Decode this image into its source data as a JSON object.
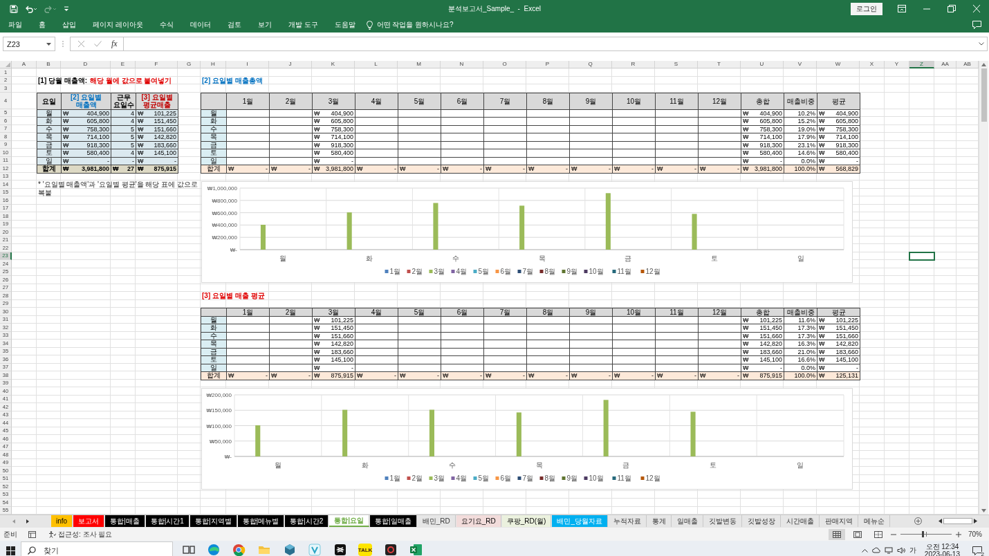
{
  "window": {
    "title": "분석보고서_Sample_  -  Excel",
    "login_button": "로그인"
  },
  "ribbon": {
    "tabs": [
      "파일",
      "홈",
      "삽입",
      "페이지 레이아웃",
      "수식",
      "데이터",
      "검토",
      "보기",
      "개발 도구",
      "도움말"
    ],
    "tell_me": "어떤 작업을 원하시나요?"
  },
  "formula_bar": {
    "name_box": "Z23",
    "function_button": "fx"
  },
  "sheet": {
    "columns": [
      {
        "label": "A",
        "selected": false
      },
      {
        "label": "B",
        "selected": false
      },
      {
        "label": "D",
        "selected": false
      },
      {
        "label": "E",
        "selected": false
      },
      {
        "label": "F",
        "selected": false
      },
      {
        "label": "G",
        "selected": false
      },
      {
        "label": "H",
        "selected": false
      },
      {
        "label": "I",
        "selected": false
      },
      {
        "label": "J",
        "selected": false
      },
      {
        "label": "K",
        "selected": false
      },
      {
        "label": "L",
        "selected": false
      },
      {
        "label": "M",
        "selected": false
      },
      {
        "label": "N",
        "selected": false
      },
      {
        "label": "O",
        "selected": false
      },
      {
        "label": "P",
        "selected": false
      },
      {
        "label": "Q",
        "selected": false
      },
      {
        "label": "R",
        "selected": false
      },
      {
        "label": "S",
        "selected": false
      },
      {
        "label": "T",
        "selected": false
      },
      {
        "label": "U",
        "selected": false
      },
      {
        "label": "V",
        "selected": false
      },
      {
        "label": "W",
        "selected": false
      },
      {
        "label": "X",
        "selected": false
      },
      {
        "label": "Y",
        "selected": false
      },
      {
        "label": "Z",
        "selected": true
      },
      {
        "label": "AA",
        "selected": false
      },
      {
        "label": "AB",
        "selected": false
      }
    ],
    "rows": [
      {
        "label": "1",
        "selected": false
      },
      {
        "label": "2",
        "selected": false
      },
      {
        "label": "3",
        "selected": false
      },
      {
        "label": "4",
        "selected": false
      },
      {
        "label": "5",
        "selected": false
      },
      {
        "label": "6",
        "selected": false
      },
      {
        "label": "7",
        "selected": false
      },
      {
        "label": "8",
        "selected": false
      },
      {
        "label": "9",
        "selected": false
      },
      {
        "label": "10",
        "selected": false
      },
      {
        "label": "11",
        "selected": false
      },
      {
        "label": "12",
        "selected": false
      },
      {
        "label": "13",
        "selected": false
      },
      {
        "label": "14",
        "selected": false
      },
      {
        "label": "15",
        "selected": false
      },
      {
        "label": "16",
        "selected": false
      },
      {
        "label": "17",
        "selected": false
      },
      {
        "label": "18",
        "selected": false
      },
      {
        "label": "19",
        "selected": false
      },
      {
        "label": "20",
        "selected": false
      },
      {
        "label": "21",
        "selected": false
      },
      {
        "label": "22",
        "selected": false
      },
      {
        "label": "23",
        "selected": true
      },
      {
        "label": "24",
        "selected": false
      },
      {
        "label": "25",
        "selected": false
      },
      {
        "label": "26",
        "selected": false
      },
      {
        "label": "27",
        "selected": false
      },
      {
        "label": "28",
        "selected": false
      },
      {
        "label": "29",
        "selected": false
      },
      {
        "label": "30",
        "selected": false
      },
      {
        "label": "31",
        "selected": false
      },
      {
        "label": "32",
        "selected": false
      },
      {
        "label": "33",
        "selected": false
      },
      {
        "label": "34",
        "selected": false
      },
      {
        "label": "35",
        "selected": false
      },
      {
        "label": "36",
        "selected": false
      },
      {
        "label": "37",
        "selected": false
      },
      {
        "label": "38",
        "selected": false
      },
      {
        "label": "39",
        "selected": false
      },
      {
        "label": "40",
        "selected": false
      },
      {
        "label": "41",
        "selected": false
      },
      {
        "label": "42",
        "selected": false
      },
      {
        "label": "43",
        "selected": false
      },
      {
        "label": "44",
        "selected": false
      },
      {
        "label": "45",
        "selected": false
      },
      {
        "label": "46",
        "selected": false
      },
      {
        "label": "47",
        "selected": false
      },
      {
        "label": "48",
        "selected": false
      },
      {
        "label": "49",
        "selected": false
      },
      {
        "label": "50",
        "selected": false
      },
      {
        "label": "51",
        "selected": false
      },
      {
        "label": "52",
        "selected": false
      },
      {
        "label": "53",
        "selected": false
      },
      {
        "label": "54",
        "selected": false
      },
      {
        "label": "55",
        "selected": false
      }
    ],
    "section_1": {
      "title": "[1] 당월 매출액:",
      "hint": "해당 월에 값으로 붙여넣기",
      "columns": [
        {
          "label": "요일"
        },
        {
          "label": "[2] 요일별 매출액",
          "color": "#0070c0"
        },
        {
          "label": "근무 요일수"
        },
        {
          "label": "[3] 요일별 평균매출",
          "color": "#c00000"
        }
      ],
      "rows": [
        [
          "월",
          [
            "₩",
            "404,900"
          ],
          "4",
          [
            "₩",
            "101,225"
          ]
        ],
        [
          "화",
          [
            "₩",
            "605,800"
          ],
          "4",
          [
            "₩",
            "151,450"
          ]
        ],
        [
          "수",
          [
            "₩",
            "758,300"
          ],
          "5",
          [
            "₩",
            "151,660"
          ]
        ],
        [
          "목",
          [
            "₩",
            "714,100"
          ],
          "5",
          [
            "₩",
            "142,820"
          ]
        ],
        [
          "금",
          [
            "₩",
            "918,300"
          ],
          "5",
          [
            "₩",
            "183,660"
          ]
        ],
        [
          "토",
          [
            "₩",
            "580,400"
          ],
          "4",
          [
            "₩",
            "145,100"
          ]
        ],
        [
          "일",
          [
            "₩",
            "-"
          ],
          "-",
          [
            "₩",
            "-"
          ]
        ],
        [
          "합계",
          [
            "₩",
            "3,981,800"
          ],
          [
            "₩",
            "27"
          ],
          [
            "₩",
            "875,915"
          ]
        ]
      ],
      "note": "* '요일별 매출액'과 '요일별 평균'을 해당 표에 값으로 복붙"
    },
    "section_2": {
      "title": "[2] 요일별 매출총액",
      "columns": [
        "",
        "1월",
        "2월",
        "3월",
        "4월",
        "5월",
        "6월",
        "7월",
        "8월",
        "9월",
        "10월",
        "11월",
        "12월",
        "총합",
        "매출비중",
        "평균"
      ],
      "rows": [
        [
          "월",
          null,
          null,
          [
            "₩",
            "404,900"
          ],
          null,
          null,
          null,
          null,
          null,
          null,
          null,
          null,
          null,
          [
            "₩",
            "404,900"
          ],
          "10.2%",
          [
            "₩",
            "404,900"
          ]
        ],
        [
          "화",
          null,
          null,
          [
            "₩",
            "605,800"
          ],
          null,
          null,
          null,
          null,
          null,
          null,
          null,
          null,
          null,
          [
            "₩",
            "605,800"
          ],
          "15.2%",
          [
            "₩",
            "605,800"
          ]
        ],
        [
          "수",
          null,
          null,
          [
            "₩",
            "758,300"
          ],
          null,
          null,
          null,
          null,
          null,
          null,
          null,
          null,
          null,
          [
            "₩",
            "758,300"
          ],
          "19.0%",
          [
            "₩",
            "758,300"
          ]
        ],
        [
          "목",
          null,
          null,
          [
            "₩",
            "714,100"
          ],
          null,
          null,
          null,
          null,
          null,
          null,
          null,
          null,
          null,
          [
            "₩",
            "714,100"
          ],
          "17.9%",
          [
            "₩",
            "714,100"
          ]
        ],
        [
          "금",
          null,
          null,
          [
            "₩",
            "918,300"
          ],
          null,
          null,
          null,
          null,
          null,
          null,
          null,
          null,
          null,
          [
            "₩",
            "918,300"
          ],
          "23.1%",
          [
            "₩",
            "918,300"
          ]
        ],
        [
          "토",
          null,
          null,
          [
            "₩",
            "580,400"
          ],
          null,
          null,
          null,
          null,
          null,
          null,
          null,
          null,
          null,
          [
            "₩",
            "580,400"
          ],
          "14.6%",
          [
            "₩",
            "580,400"
          ]
        ],
        [
          "일",
          null,
          null,
          [
            "₩",
            "-"
          ],
          null,
          null,
          null,
          null,
          null,
          null,
          null,
          null,
          null,
          [
            "₩",
            "-"
          ],
          "0.0%",
          [
            "₩",
            "-"
          ]
        ],
        [
          "합계",
          [
            "₩",
            "-"
          ],
          [
            "₩",
            "-"
          ],
          [
            "₩",
            "3,981,800"
          ],
          [
            "₩",
            "-"
          ],
          [
            "₩",
            "-"
          ],
          [
            "₩",
            "-"
          ],
          [
            "₩",
            "-"
          ],
          [
            "₩",
            "-"
          ],
          [
            "₩",
            "-"
          ],
          [
            "₩",
            "-"
          ],
          [
            "₩",
            "-"
          ],
          [
            "₩",
            "-"
          ],
          [
            "₩",
            "3,981,800"
          ],
          "100.0%",
          [
            "₩",
            "568,829"
          ]
        ]
      ],
      "chart_data": {
        "type": "bar",
        "grid": true,
        "categories": [
          "월",
          "화",
          "수",
          "목",
          "금",
          "토",
          "일"
        ],
        "ylim": [
          0,
          1000000
        ],
        "yticks": [
          {
            "value": 0,
            "label": "₩-"
          },
          {
            "value": 200000,
            "label": "₩200,000"
          },
          {
            "value": 400000,
            "label": "₩400,000"
          },
          {
            "value": 600000,
            "label": "₩600,000"
          },
          {
            "value": 800000,
            "label": "₩800,000"
          },
          {
            "value": 1000000,
            "label": "₩1,000,000"
          }
        ],
        "series": [
          {
            "name": "1월",
            "color": "#4f81bd",
            "values": [
              null,
              null,
              null,
              null,
              null,
              null,
              null
            ]
          },
          {
            "name": "2월",
            "color": "#c0504d",
            "values": [
              null,
              null,
              null,
              null,
              null,
              null,
              null
            ]
          },
          {
            "name": "3월",
            "color": "#9bbb59",
            "values": [
              404900,
              605800,
              758300,
              714100,
              918300,
              580400,
              0
            ]
          },
          {
            "name": "4월",
            "color": "#8064a2",
            "values": [
              null,
              null,
              null,
              null,
              null,
              null,
              null
            ]
          },
          {
            "name": "5월",
            "color": "#4bacc6",
            "values": [
              null,
              null,
              null,
              null,
              null,
              null,
              null
            ]
          },
          {
            "name": "6월",
            "color": "#f79646",
            "values": [
              null,
              null,
              null,
              null,
              null,
              null,
              null
            ]
          },
          {
            "name": "7월",
            "color": "#2c4d75",
            "values": [
              null,
              null,
              null,
              null,
              null,
              null,
              null
            ]
          },
          {
            "name": "8월",
            "color": "#772c2a",
            "values": [
              null,
              null,
              null,
              null,
              null,
              null,
              null
            ]
          },
          {
            "name": "9월",
            "color": "#5f7530",
            "values": [
              null,
              null,
              null,
              null,
              null,
              null,
              null
            ]
          },
          {
            "name": "10월",
            "color": "#4d3b62",
            "values": [
              null,
              null,
              null,
              null,
              null,
              null,
              null
            ]
          },
          {
            "name": "11월",
            "color": "#276a7c",
            "values": [
              null,
              null,
              null,
              null,
              null,
              null,
              null
            ]
          },
          {
            "name": "12월",
            "color": "#b65708",
            "values": [
              null,
              null,
              null,
              null,
              null,
              null,
              null
            ]
          }
        ]
      }
    },
    "section_3": {
      "title": "[3] 요일별 매출 평균",
      "columns": [
        "",
        "1월",
        "2월",
        "3월",
        "4월",
        "5월",
        "6월",
        "7월",
        "8월",
        "9월",
        "10월",
        "11월",
        "12월",
        "총합",
        "매출비중",
        "평균"
      ],
      "rows": [
        [
          "월",
          null,
          null,
          [
            "₩",
            "101,225"
          ],
          null,
          null,
          null,
          null,
          null,
          null,
          null,
          null,
          null,
          [
            "₩",
            "101,225"
          ],
          "11.6%",
          [
            "₩",
            "101,225"
          ]
        ],
        [
          "화",
          null,
          null,
          [
            "₩",
            "151,450"
          ],
          null,
          null,
          null,
          null,
          null,
          null,
          null,
          null,
          null,
          [
            "₩",
            "151,450"
          ],
          "17.3%",
          [
            "₩",
            "151,450"
          ]
        ],
        [
          "수",
          null,
          null,
          [
            "₩",
            "151,660"
          ],
          null,
          null,
          null,
          null,
          null,
          null,
          null,
          null,
          null,
          [
            "₩",
            "151,660"
          ],
          "17.3%",
          [
            "₩",
            "151,660"
          ]
        ],
        [
          "목",
          null,
          null,
          [
            "₩",
            "142,820"
          ],
          null,
          null,
          null,
          null,
          null,
          null,
          null,
          null,
          null,
          [
            "₩",
            "142,820"
          ],
          "16.3%",
          [
            "₩",
            "142,820"
          ]
        ],
        [
          "금",
          null,
          null,
          [
            "₩",
            "183,660"
          ],
          null,
          null,
          null,
          null,
          null,
          null,
          null,
          null,
          null,
          [
            "₩",
            "183,660"
          ],
          "21.0%",
          [
            "₩",
            "183,660"
          ]
        ],
        [
          "토",
          null,
          null,
          [
            "₩",
            "145,100"
          ],
          null,
          null,
          null,
          null,
          null,
          null,
          null,
          null,
          null,
          [
            "₩",
            "145,100"
          ],
          "16.6%",
          [
            "₩",
            "145,100"
          ]
        ],
        [
          "일",
          null,
          null,
          [
            "₩",
            "-"
          ],
          null,
          null,
          null,
          null,
          null,
          null,
          null,
          null,
          null,
          [
            "₩",
            "-"
          ],
          "0.0%",
          [
            "₩",
            "-"
          ]
        ],
        [
          "합계",
          [
            "₩",
            "-"
          ],
          [
            "₩",
            "-"
          ],
          [
            "₩",
            "875,915"
          ],
          [
            "₩",
            "-"
          ],
          [
            "₩",
            "-"
          ],
          [
            "₩",
            "-"
          ],
          [
            "₩",
            "-"
          ],
          [
            "₩",
            "-"
          ],
          [
            "₩",
            "-"
          ],
          [
            "₩",
            "-"
          ],
          [
            "₩",
            "-"
          ],
          [
            "₩",
            "-"
          ],
          [
            "₩",
            "875,915"
          ],
          "100.0%",
          [
            "₩",
            "125,131"
          ]
        ]
      ],
      "chart_data": {
        "type": "bar",
        "grid": true,
        "categories": [
          "월",
          "화",
          "수",
          "목",
          "금",
          "토",
          "일"
        ],
        "ylim": [
          0,
          200000
        ],
        "yticks": [
          {
            "value": 0,
            "label": "₩-"
          },
          {
            "value": 50000,
            "label": "₩50,000"
          },
          {
            "value": 100000,
            "label": "₩100,000"
          },
          {
            "value": 150000,
            "label": "₩150,000"
          },
          {
            "value": 200000,
            "label": "₩200,000"
          }
        ],
        "series": [
          {
            "name": "1월",
            "color": "#4f81bd",
            "values": [
              null,
              null,
              null,
              null,
              null,
              null,
              null
            ]
          },
          {
            "name": "2월",
            "color": "#c0504d",
            "values": [
              null,
              null,
              null,
              null,
              null,
              null,
              null
            ]
          },
          {
            "name": "3월",
            "color": "#9bbb59",
            "values": [
              101225,
              151450,
              151660,
              142820,
              183660,
              145100,
              0
            ]
          },
          {
            "name": "4월",
            "color": "#8064a2",
            "values": [
              null,
              null,
              null,
              null,
              null,
              null,
              null
            ]
          },
          {
            "name": "5월",
            "color": "#4bacc6",
            "values": [
              null,
              null,
              null,
              null,
              null,
              null,
              null
            ]
          },
          {
            "name": "6월",
            "color": "#f79646",
            "values": [
              null,
              null,
              null,
              null,
              null,
              null,
              null
            ]
          },
          {
            "name": "7월",
            "color": "#2c4d75",
            "values": [
              null,
              null,
              null,
              null,
              null,
              null,
              null
            ]
          },
          {
            "name": "8월",
            "color": "#772c2a",
            "values": [
              null,
              null,
              null,
              null,
              null,
              null,
              null
            ]
          },
          {
            "name": "9월",
            "color": "#5f7530",
            "values": [
              null,
              null,
              null,
              null,
              null,
              null,
              null
            ]
          },
          {
            "name": "10월",
            "color": "#4d3b62",
            "values": [
              null,
              null,
              null,
              null,
              null,
              null,
              null
            ]
          },
          {
            "name": "11월",
            "color": "#276a7c",
            "values": [
              null,
              null,
              null,
              null,
              null,
              null,
              null
            ]
          },
          {
            "name": "12월",
            "color": "#b65708",
            "values": [
              null,
              null,
              null,
              null,
              null,
              null,
              null
            ]
          }
        ]
      }
    }
  },
  "sheet_tabs": [
    {
      "label": "info",
      "color": "#ffc000",
      "selected": false
    },
    {
      "label": "보고서",
      "color": "#ff0000",
      "selected": false
    },
    {
      "label": "통합|매출",
      "color": "#000000",
      "selected": false
    },
    {
      "label": "통합|시간1",
      "color": "#000000",
      "selected": false
    },
    {
      "label": "통합|지역별",
      "color": "#000000",
      "selected": false
    },
    {
      "label": "통합|메뉴별",
      "color": "#000000",
      "selected": false
    },
    {
      "label": "통합|시간2",
      "color": "#000000",
      "selected": false
    },
    {
      "label": "통합|요일",
      "color": "#70ad47",
      "selected": true
    },
    {
      "label": "통합|일매출",
      "color": "#000000",
      "selected": false
    },
    {
      "label": "배민_RD",
      "selected": false
    },
    {
      "label": "요기요_RD",
      "color": "#f2dcdb",
      "selected": false
    },
    {
      "label": "쿠팡_RD(월)",
      "color": "#ebf1de",
      "selected": false
    },
    {
      "label": "배민_당월자료",
      "color": "#00b0f0",
      "selected": false
    },
    {
      "label": "누적자료",
      "selected": false
    },
    {
      "label": "통계",
      "selected": false
    },
    {
      "label": "일매출",
      "selected": false
    },
    {
      "label": "깃발변동",
      "selected": false
    },
    {
      "label": "깃발성장",
      "selected": false
    },
    {
      "label": "시간매출",
      "selected": false
    },
    {
      "label": "판매지역",
      "selected": false
    },
    {
      "label": "메뉴순",
      "selected": false
    }
  ],
  "status_bar": {
    "ready": "준비",
    "accessibility": "접근성: 조사 필요",
    "views": [
      {
        "kind": "normal",
        "selected": true
      },
      {
        "kind": "page-layout",
        "selected": false
      },
      {
        "kind": "page-break",
        "selected": false
      }
    ],
    "zoom_slider": {
      "level": 0.43
    },
    "zoom": "70%"
  },
  "taskbar": {
    "search_placeholder": "찾기",
    "apps": [
      {
        "kind": "task-view"
      },
      {
        "kind": "edge"
      },
      {
        "kind": "chrome"
      },
      {
        "kind": "files"
      },
      {
        "kind": "cube"
      },
      {
        "kind": "vapp"
      },
      {
        "kind": "clip"
      },
      {
        "kind": "chat",
        "label": "TALK"
      },
      {
        "kind": "recorder"
      },
      {
        "kind": "excel"
      }
    ],
    "ime": "가",
    "time": "오전 12:34",
    "date": "2023-06-13",
    "notifications": "2"
  }
}
